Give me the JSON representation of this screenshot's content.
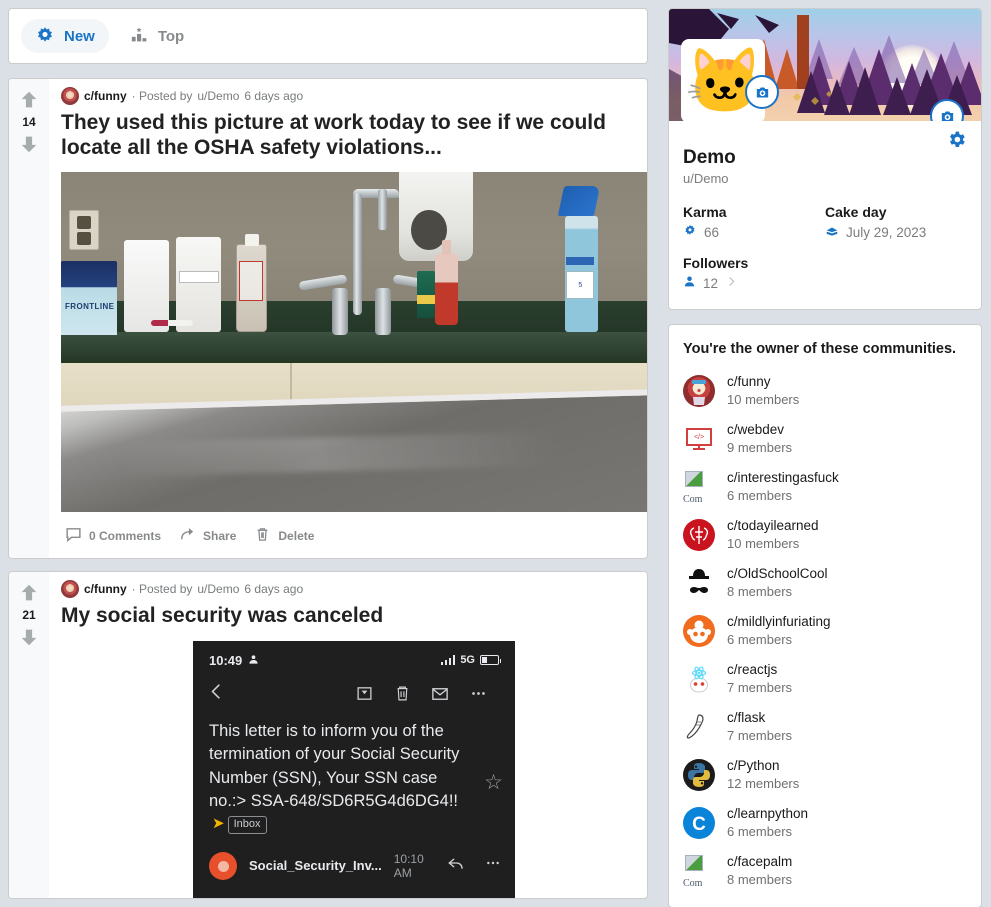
{
  "sortbar": {
    "tabs": [
      {
        "label": "New",
        "icon": "starburst-icon",
        "active": true
      },
      {
        "label": "Top",
        "icon": "bar-chart-star-icon",
        "active": false
      }
    ]
  },
  "posts": [
    {
      "community": "c/funny",
      "posted_by_prefix": "· Posted by",
      "author": "u/Demo",
      "age": "6 days ago",
      "score": "14",
      "title": "They used this picture at work today to see if we could locate all the OSHA safety violations...",
      "media": "vet-clinic-photo",
      "actions": [
        {
          "label": "0 Comments",
          "icon": "comment-icon"
        },
        {
          "label": "Share",
          "icon": "share-icon"
        },
        {
          "label": "Delete",
          "icon": "trash-icon"
        }
      ]
    },
    {
      "community": "c/funny",
      "posted_by_prefix": "· Posted by",
      "author": "u/Demo",
      "age": "6 days ago",
      "score": "21",
      "title": "My social security was canceled",
      "media": "phone-email-screenshot",
      "phone": {
        "time": "10:49",
        "network": "5G",
        "subject": "This letter is to inform you of the termination of your Social Security Number (SSN), Your SSN case no.:> SSA-648/SD6R5G4d6DG4!!",
        "label": "Inbox",
        "sender": "Social_Security_Inv...",
        "sent_time": "10:10 AM"
      }
    }
  ],
  "profile": {
    "name": "Demo",
    "handle": "u/Demo",
    "karma_label": "Karma",
    "karma_value": "66",
    "cakeday_label": "Cake day",
    "cakeday_value": "July 29, 2023",
    "followers_label": "Followers",
    "followers_value": "12"
  },
  "communities": {
    "heading": "You're the owner of these communities.",
    "items": [
      {
        "name": "c/funny",
        "members": "10 members",
        "icon": "clown-avatar"
      },
      {
        "name": "c/webdev",
        "members": "9 members",
        "icon": "code-monitor-icon"
      },
      {
        "name": "c/interestingasfuck",
        "members": "6 members",
        "icon": "broken-image-icon"
      },
      {
        "name": "c/todayilearned",
        "members": "10 members",
        "icon": "red-brain-icon"
      },
      {
        "name": "c/OldSchoolCool",
        "members": "8 members",
        "icon": "bowler-hat-mustache-icon"
      },
      {
        "name": "c/mildlyinfuriating",
        "members": "6 members",
        "icon": "orange-snoo-icon"
      },
      {
        "name": "c/reactjs",
        "members": "7 members",
        "icon": "react-snoo-icon"
      },
      {
        "name": "c/flask",
        "members": "7 members",
        "icon": "flask-horn-icon"
      },
      {
        "name": "c/Python",
        "members": "12 members",
        "icon": "python-logo-icon"
      },
      {
        "name": "c/learnpython",
        "members": "6 members",
        "icon": "blue-c-icon"
      },
      {
        "name": "c/facepalm",
        "members": "8 members",
        "icon": "broken-image-icon"
      }
    ]
  },
  "colors": {
    "page_background": "#dae0e6",
    "accent_blue": "#1a73c7",
    "muted_text": "#878a8c",
    "card_background": "#ffffff"
  }
}
